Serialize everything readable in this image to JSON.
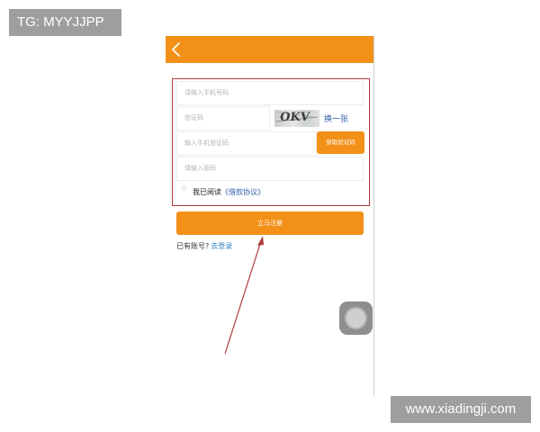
{
  "overlay": {
    "tg_label": "TG: MYYJJPP",
    "watermark": "www.xiadingji.com"
  },
  "header": {
    "back_icon": "chevron-left-icon"
  },
  "form": {
    "phone_placeholder": "请输入手机号码",
    "captcha_placeholder": "验证码",
    "captcha_text": "OKV",
    "refresh_label": "换一张",
    "sms_code_placeholder": "输入手机验证码",
    "sms_button_label": "获取验证码",
    "password_placeholder": "请输入密码",
    "agree_prefix": "我已阅读",
    "agree_link": "《借款协议》",
    "register_label": "立马注册",
    "login_prompt": "已有账号?",
    "login_link": "去登录"
  },
  "colors": {
    "accent": "#f29018",
    "annotation": "#b23a3a",
    "link": "#2e5ea8"
  },
  "icons": {
    "assistive_touch": "assistive-touch-icon"
  }
}
